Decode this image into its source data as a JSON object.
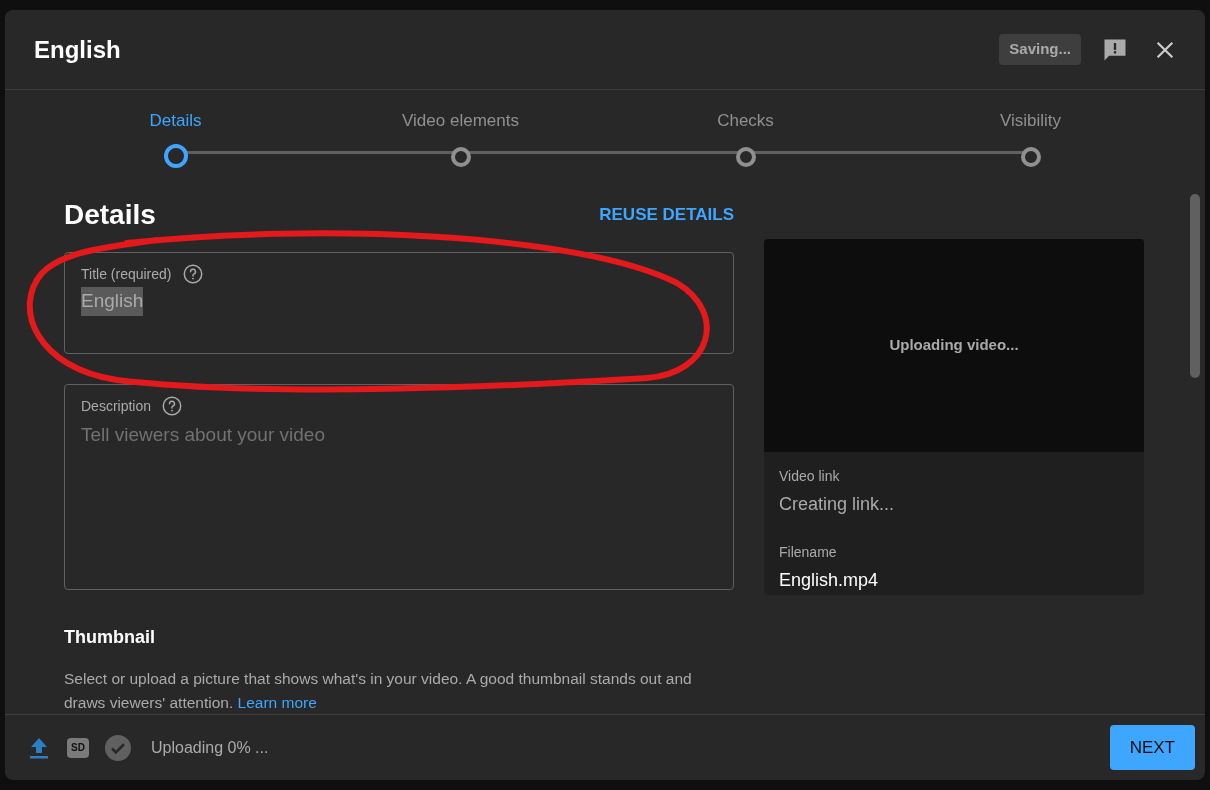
{
  "dialog": {
    "title": "English",
    "status_badge": "Saving..."
  },
  "steps": [
    {
      "label": "Details",
      "selected": true
    },
    {
      "label": "Video elements",
      "selected": false
    },
    {
      "label": "Checks",
      "selected": false
    },
    {
      "label": "Visibility",
      "selected": false
    }
  ],
  "details": {
    "heading": "Details",
    "reuse_link": "REUSE DETAILS",
    "title_field": {
      "label": "Title (required)",
      "value": "English",
      "value_selected": true
    },
    "description_field": {
      "label": "Description",
      "placeholder": "Tell viewers about your video"
    },
    "thumbnail": {
      "heading": "Thumbnail",
      "text": "Select or upload a picture that shows what's in your video. A good thumbnail stands out and draws viewers' attention.",
      "link": "Learn more"
    }
  },
  "preview": {
    "status": "Uploading video...",
    "link_label": "Video link",
    "link_value": "Creating link...",
    "filename_label": "Filename",
    "filename": "English.mp4"
  },
  "footer": {
    "sd_badge": "SD",
    "status": "Uploading 0% ...",
    "next_button": "NEXT"
  }
}
